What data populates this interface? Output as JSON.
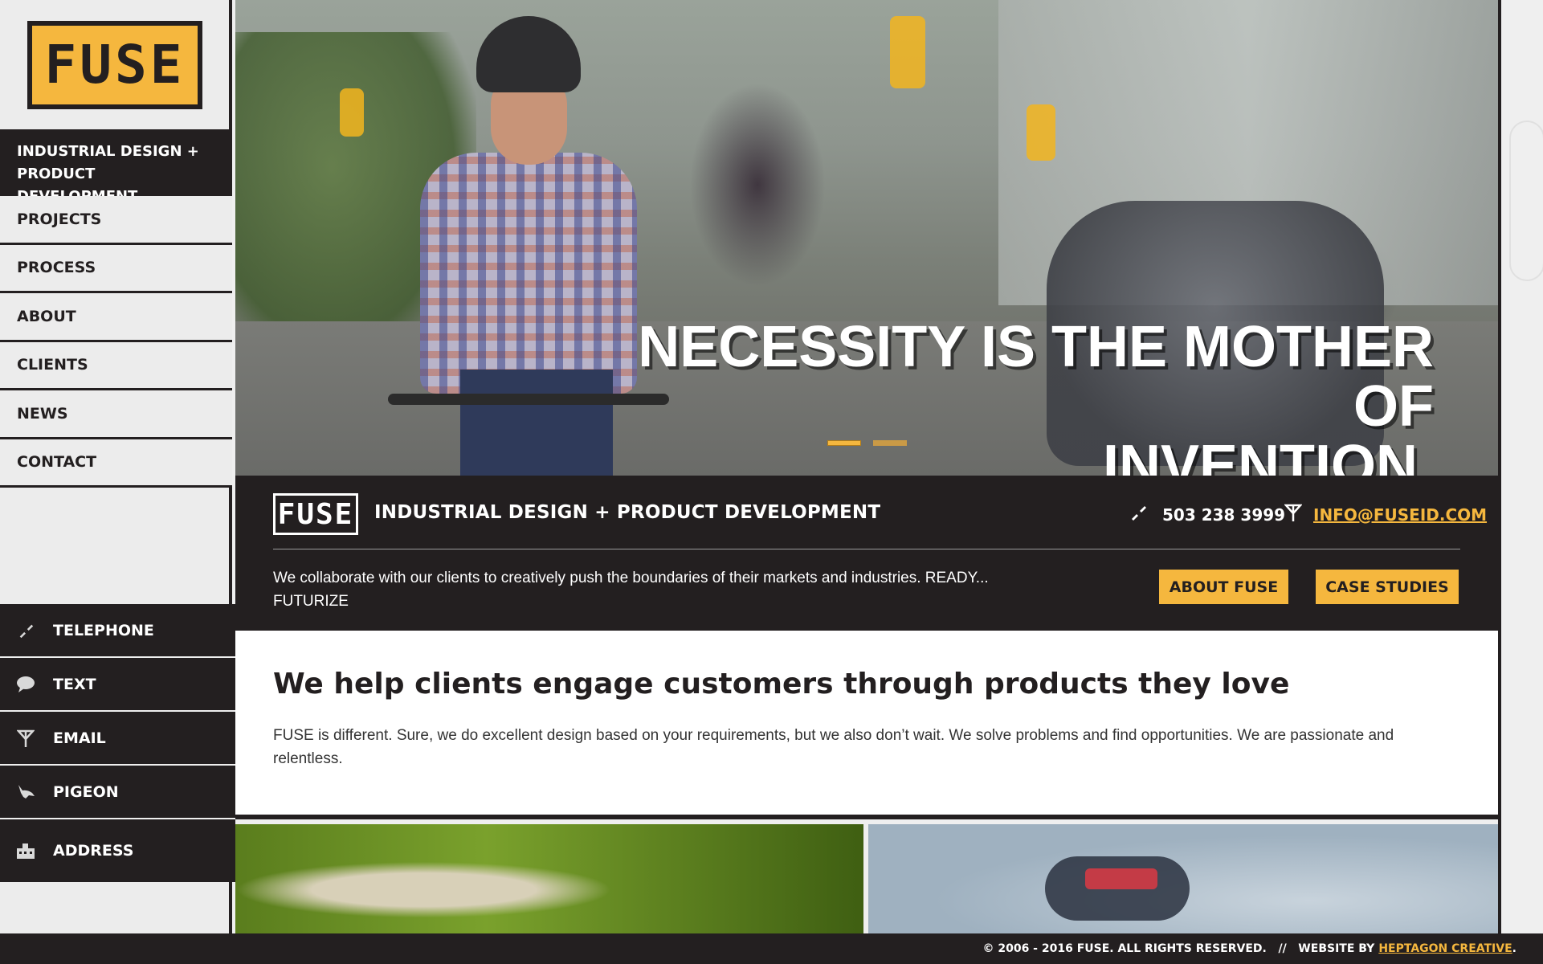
{
  "logo": {
    "text": "FUSE"
  },
  "sidebar": {
    "tagline": "INDUSTRIAL DESIGN + PRODUCT DEVELOPMENT",
    "nav": [
      "PROJECTS",
      "PROCESS",
      "ABOUT",
      "CLIENTS",
      "NEWS",
      "CONTACT"
    ],
    "contacts": [
      {
        "label": "TELEPHONE",
        "icon": "phone-icon"
      },
      {
        "label": "TEXT",
        "icon": "speech-bubble-icon"
      },
      {
        "label": "EMAIL",
        "icon": "email-antenna-icon"
      },
      {
        "label": "PIGEON",
        "icon": "pigeon-icon"
      },
      {
        "label": "ADDRESS",
        "icon": "building-icon"
      }
    ]
  },
  "hero": {
    "headline_line1": "NECESSITY IS THE MOTHER OF",
    "headline_line2": "INVENTION.",
    "slides_total": 2,
    "active_slide": 1
  },
  "infobar": {
    "logo_text": "FUSE",
    "title": "INDUSTRIAL DESIGN + PRODUCT DEVELOPMENT",
    "phone": "503 238 3999",
    "email": "INFO@FUSEID.COM",
    "description": "We collaborate with our clients to creatively push the boundaries of their markets and industries. READY... FUTURIZE",
    "about_button": "ABOUT FUSE",
    "case_button": "CASE STUDIES"
  },
  "intro": {
    "heading": "We help clients engage customers through products they love",
    "body": "FUSE is different.  Sure, we do excellent design based on your requirements,  but we also don’t wait. We solve problems and find opportunities. We are passionate and relentless."
  },
  "footer": {
    "copyright": "© 2006 - 2016 FUSE. ALL RIGHTS RESERVED.   //   WEBSITE BY",
    "credit_link": "HEPTAGON CREATIVE",
    "end": "."
  },
  "colors": {
    "accent": "#f5b73e",
    "dark": "#231f20",
    "sidebar_bg": "#ececec"
  }
}
